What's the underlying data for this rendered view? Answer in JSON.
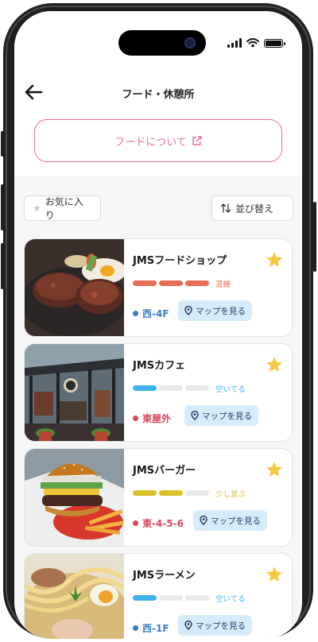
{
  "header": {
    "title": "フード・休憩所"
  },
  "about_button": {
    "label": "フードについて"
  },
  "filters": {
    "favorite_label": "お気に入り",
    "sort_label": "並び替え"
  },
  "colors": {
    "accent_pink": "#ea6e93",
    "star_yellow": "#f6c944",
    "map_bg": "#d7ecfb",
    "busy": "#e86d57",
    "empty": "#3fb4ec",
    "medium": "#d9c12b"
  },
  "shops": [
    {
      "name": "JMSフードショップ",
      "status": "混雑",
      "status_color": "#e86d57",
      "crowd_level": 3,
      "location": "西-4F",
      "location_color": "#3a7fc4",
      "map_label": "マップを見る",
      "favorite": true
    },
    {
      "name": "JMSカフェ",
      "status": "空いてる",
      "status_color": "#3fb4ec",
      "crowd_level": 1,
      "location": "東屋外",
      "location_color": "#d9475f",
      "map_label": "マップを見る",
      "favorite": true
    },
    {
      "name": "JMSバーガー",
      "status": "少し並ぶ",
      "status_color": "#d9c12b",
      "crowd_level": 2,
      "location": "東-4-5-6",
      "location_color": "#d9475f",
      "map_label": "マップを見る",
      "favorite": true
    },
    {
      "name": "JMSラーメン",
      "status": "空いてる",
      "status_color": "#3fb4ec",
      "crowd_level": 1,
      "location": "西-1F",
      "location_color": "#3a7fc4",
      "map_label": "マップを見る",
      "favorite": true
    }
  ]
}
